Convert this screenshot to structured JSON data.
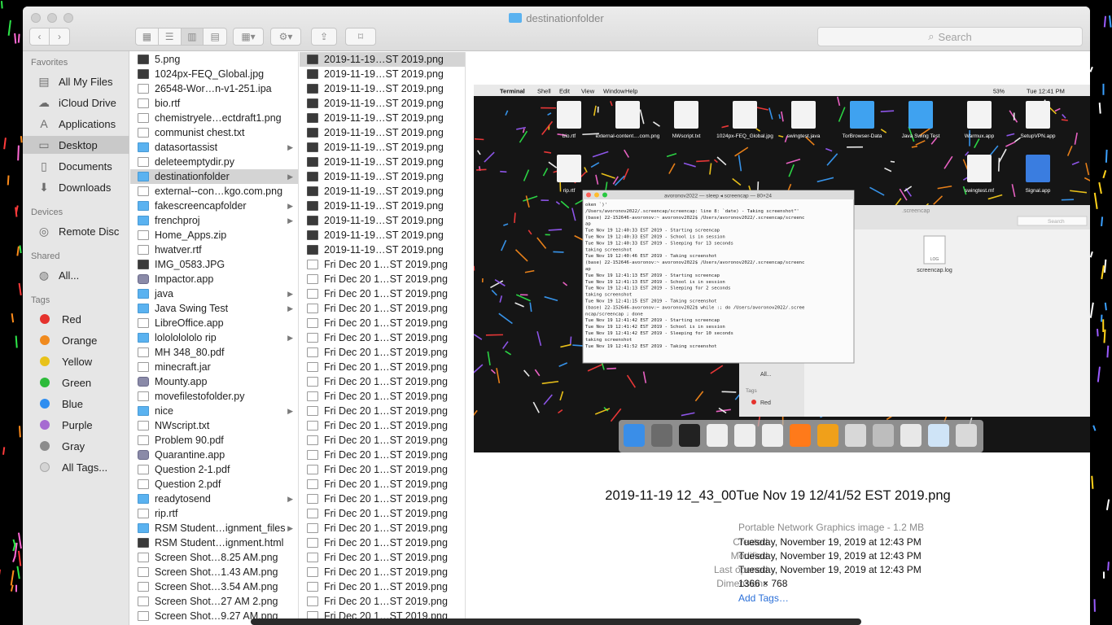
{
  "window": {
    "title": "destinationfolder"
  },
  "toolbar": {
    "search_placeholder": "Search"
  },
  "sidebar": {
    "favorites_heading": "Favorites",
    "favorites": [
      {
        "label": "All My Files",
        "icon": "all-files-icon"
      },
      {
        "label": "iCloud Drive",
        "icon": "cloud-icon"
      },
      {
        "label": "Applications",
        "icon": "applications-icon"
      },
      {
        "label": "Desktop",
        "icon": "desktop-icon"
      },
      {
        "label": "Documents",
        "icon": "documents-icon"
      },
      {
        "label": "Downloads",
        "icon": "downloads-icon"
      }
    ],
    "devices_heading": "Devices",
    "devices": [
      {
        "label": "Remote Disc",
        "icon": "disc-icon"
      }
    ],
    "shared_heading": "Shared",
    "shared": [
      {
        "label": "All...",
        "icon": "network-icon"
      }
    ],
    "tags_heading": "Tags",
    "tags": [
      {
        "label": "Red",
        "color": "#e5322d"
      },
      {
        "label": "Orange",
        "color": "#f08a1e"
      },
      {
        "label": "Yellow",
        "color": "#e8c21a"
      },
      {
        "label": "Green",
        "color": "#2dbb3a"
      },
      {
        "label": "Blue",
        "color": "#2f8ef0"
      },
      {
        "label": "Purple",
        "color": "#a66bd1"
      },
      {
        "label": "Gray",
        "color": "#8c8c8c"
      },
      {
        "label": "All Tags...",
        "color": "#d4d4d4"
      }
    ]
  },
  "column1": [
    {
      "name": "5.png",
      "type": "img"
    },
    {
      "name": "1024px-FEQ_Global.jpg",
      "type": "img"
    },
    {
      "name": "26548-Wor…n-v1-251.ipa",
      "type": "doc"
    },
    {
      "name": "bio.rtf",
      "type": "doc"
    },
    {
      "name": "chemistryele…ectdraft1.png",
      "type": "doc"
    },
    {
      "name": "communist chest.txt",
      "type": "doc"
    },
    {
      "name": "datasortassist",
      "type": "folder",
      "arrow": true
    },
    {
      "name": "deleteemptydir.py",
      "type": "doc"
    },
    {
      "name": "destinationfolder",
      "type": "folder",
      "arrow": true,
      "selected": true
    },
    {
      "name": "external--con…kgo.com.png",
      "type": "doc"
    },
    {
      "name": "fakescreencapfolder",
      "type": "folder",
      "arrow": true
    },
    {
      "name": "frenchproj",
      "type": "folder",
      "arrow": true
    },
    {
      "name": "Home_Apps.zip",
      "type": "doc"
    },
    {
      "name": "hwatver.rtf",
      "type": "doc"
    },
    {
      "name": "IMG_0583.JPG",
      "type": "img"
    },
    {
      "name": "Impactor.app",
      "type": "app"
    },
    {
      "name": "java",
      "type": "folder",
      "arrow": true
    },
    {
      "name": "Java Swing Test",
      "type": "folder",
      "arrow": true
    },
    {
      "name": "LibreOffice.app",
      "type": "doc"
    },
    {
      "name": "lolololololo rip",
      "type": "folder",
      "arrow": true
    },
    {
      "name": "MH 348_80.pdf",
      "type": "doc"
    },
    {
      "name": "minecraft.jar",
      "type": "doc"
    },
    {
      "name": "Mounty.app",
      "type": "app"
    },
    {
      "name": "movefilestofolder.py",
      "type": "doc"
    },
    {
      "name": "nice",
      "type": "folder",
      "arrow": true
    },
    {
      "name": "NWscript.txt",
      "type": "doc"
    },
    {
      "name": "Problem 90.pdf",
      "type": "doc"
    },
    {
      "name": "Quarantine.app",
      "type": "app"
    },
    {
      "name": "Question 2-1.pdf",
      "type": "doc"
    },
    {
      "name": "Question 2.pdf",
      "type": "doc"
    },
    {
      "name": "readytosend",
      "type": "folder",
      "arrow": true
    },
    {
      "name": "rip.rtf",
      "type": "doc"
    },
    {
      "name": "RSM Student…ignment_files",
      "type": "folder",
      "arrow": true
    },
    {
      "name": "RSM Student…ignment.html",
      "type": "img"
    },
    {
      "name": "Screen Shot…8.25 AM.png",
      "type": "doc"
    },
    {
      "name": "Screen Shot…1.43 AM.png",
      "type": "doc"
    },
    {
      "name": "Screen Shot…3.54 AM.png",
      "type": "doc"
    },
    {
      "name": "Screen Shot…27 AM 2.png",
      "type": "doc"
    },
    {
      "name": "Screen Shot…9.27 AM.png",
      "type": "doc"
    }
  ],
  "column2": [
    {
      "name": "2019-11-19…ST 2019.png",
      "selected": true
    },
    {
      "name": "2019-11-19…ST 2019.png"
    },
    {
      "name": "2019-11-19…ST 2019.png"
    },
    {
      "name": "2019-11-19…ST 2019.png"
    },
    {
      "name": "2019-11-19…ST 2019.png"
    },
    {
      "name": "2019-11-19…ST 2019.png"
    },
    {
      "name": "2019-11-19…ST 2019.png"
    },
    {
      "name": "2019-11-19…ST 2019.png"
    },
    {
      "name": "2019-11-19…ST 2019.png"
    },
    {
      "name": "2019-11-19…ST 2019.png"
    },
    {
      "name": "2019-11-19…ST 2019.png"
    },
    {
      "name": "2019-11-19…ST 2019.png"
    },
    {
      "name": "2019-11-19…ST 2019.png"
    },
    {
      "name": "2019-11-19…ST 2019.png"
    },
    {
      "name": "Fri Dec 20 1…ST 2019.png"
    },
    {
      "name": "Fri Dec 20 1…ST 2019.png"
    },
    {
      "name": "Fri Dec 20 1…ST 2019.png"
    },
    {
      "name": "Fri Dec 20 1…ST 2019.png"
    },
    {
      "name": "Fri Dec 20 1…ST 2019.png"
    },
    {
      "name": "Fri Dec 20 1…ST 2019.png"
    },
    {
      "name": "Fri Dec 20 1…ST 2019.png"
    },
    {
      "name": "Fri Dec 20 1…ST 2019.png"
    },
    {
      "name": "Fri Dec 20 1…ST 2019.png"
    },
    {
      "name": "Fri Dec 20 1…ST 2019.png"
    },
    {
      "name": "Fri Dec 20 1…ST 2019.png"
    },
    {
      "name": "Fri Dec 20 1…ST 2019.png"
    },
    {
      "name": "Fri Dec 20 1…ST 2019.png"
    },
    {
      "name": "Fri Dec 20 1…ST 2019.png"
    },
    {
      "name": "Fri Dec 20 1…ST 2019.png"
    },
    {
      "name": "Fri Dec 20 1…ST 2019.png"
    },
    {
      "name": "Fri Dec 20 1…ST 2019.png"
    },
    {
      "name": "Fri Dec 20 1…ST 2019.png"
    },
    {
      "name": "Fri Dec 20 1…ST 2019.png"
    },
    {
      "name": "Fri Dec 20 1…ST 2019.png"
    },
    {
      "name": "Fri Dec 20 1…ST 2019.png"
    },
    {
      "name": "Fri Dec 20 1…ST 2019.png"
    },
    {
      "name": "Fri Dec 20 1…ST 2019.png"
    },
    {
      "name": "Fri Dec 20 1…ST 2019.png"
    },
    {
      "name": "Fri Dec 20 1…ST 2019.png"
    }
  ],
  "preview": {
    "filename": "2019-11-19 12_43_00Tue Nov 19 12/41/52 EST 2019.png",
    "kind": "Portable Network Graphics image - 1.2 MB",
    "created_label": "Created",
    "created": "Tuesday, November 19, 2019 at 12:43 PM",
    "modified_label": "Modified",
    "modified": "Tuesday, November 19, 2019 at 12:43 PM",
    "opened_label": "Last opened",
    "opened": "Tuesday, November 19, 2019 at 12:43 PM",
    "dimensions_label": "Dimensions",
    "dimensions": "1366 × 768",
    "add_tags": "Add Tags…"
  },
  "thumbnail": {
    "menubar": {
      "app": "Terminal",
      "menus": [
        "Shell",
        "Edit",
        "View",
        "Window",
        "Help"
      ],
      "battery": "53%",
      "clock": "Tue 12:41 PM"
    },
    "desktop_icons_row1": [
      "bio.rtf",
      "external-content....com.png",
      "NWscript.txt",
      "1024px-FEQ_Global.jpg",
      "swingtest.java",
      "TorBrowser-Data",
      "Java Swing Test",
      "Warmux.app",
      "SetupVPN.app"
    ],
    "desktop_icons_row2": [
      "rip.rtf",
      "",
      "",
      "",
      "",
      "",
      "",
      "swingtest.mf",
      "Signal.app"
    ],
    "terminal": {
      "title": "avoronov2022 — sleep ◂ screencap — 80×24",
      "lines": [
        "oken `)'",
        "/Users/avoronov2022/.screencap/screencap: line 8: `date) - Taking screenshot\"'",
        "(base) 22-152646-avoronov:~ avoronov2022$ /Users/avoronov2022/.screencap/screenc",
        "ap",
        "Tue Nov 19 12:40:33 EST 2019 - Starting screencap",
        "Tue Nov 19 12:40:33 EST 2019 - School is in session",
        "Tue Nov 19 12:40:33 EST 2019 - Sleeping for 13 seconds",
        "taking screenshot",
        "Tue Nov 19 12:40:46 EST 2019 - Taking screenshot",
        "(base) 22-152646-avoronov:~ avoronov2022$ /Users/avoronov2022/.screencap/screenc",
        "ap",
        "Tue Nov 19 12:41:13 EST 2019 - Starting screencap",
        "Tue Nov 19 12:41:13 EST 2019 - School is in session",
        "Tue Nov 19 12:41:13 EST 2019 - Sleeping for 2 seconds",
        "taking screenshot",
        "Tue Nov 19 12:41:15 EST 2019 - Taking screenshot",
        "(base) 22-152646-avoronov:~ avoronov2022$ while :; do /Users/avoronov2022/.scree",
        "ncap/screencap ; done",
        "Tue Nov 19 12:41:42 EST 2019 - Starting screencap",
        "Tue Nov 19 12:41:42 EST 2019 - School is in session",
        "Tue Nov 19 12:41:42 EST 2019 - Sleeping for 10 seconds",
        "taking screenshot",
        "Tue Nov 19 12:41:52 EST 2019 - Taking screenshot"
      ]
    },
    "mini_finder": {
      "title": ".screencap",
      "search": "Search",
      "file_label": "screencap.log",
      "file_badge": "LOG",
      "sidebar_all": "All...",
      "tags_heading": "Tags",
      "tag_red": "Red"
    }
  }
}
